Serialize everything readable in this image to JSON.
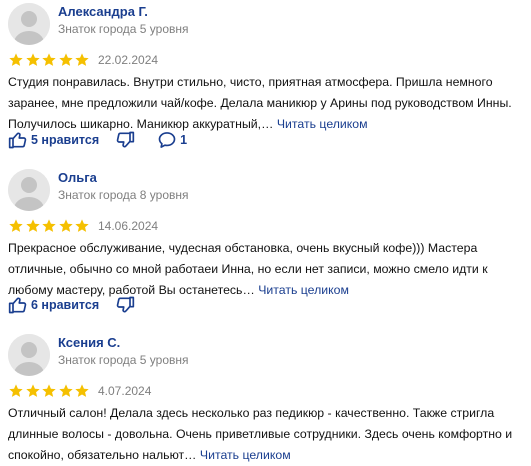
{
  "colors": {
    "link": "#1a3e8f",
    "star": "#f5c000",
    "meta": "#7f7f7f"
  },
  "icons": [
    "avatar-placeholder",
    "star-icon",
    "thumbs-up-icon",
    "thumbs-down-icon",
    "comment-icon"
  ],
  "reviews": [
    {
      "author": "Александра Г.",
      "level": "Знаток города 5 уровня",
      "rating": 5,
      "date": "22.02.2024",
      "text": "Студия понравилась. Внутри стильно, чисто, приятная атмосфера. Пришла немного заранее, мне предложили чай/кофе. Делала маникюр у Арины под руководством Инны. Получилось шикарно. Маникюр аккуратный,…",
      "more": "Читать целиком",
      "likes": "5 нравится",
      "comments": "1"
    },
    {
      "author": "Ольга",
      "level": "Знаток города 8 уровня",
      "rating": 5,
      "date": "14.06.2024",
      "text": "Прекрасное обслуживание, чудесная обстановка, очень вкусный кофе))) Мастера отличные, обычно со мной работаеи Инна, но если нет записи, можно смело идти к любому мастеру, работой Вы останетесь…",
      "more": "Читать целиком",
      "likes": "6 нравится"
    },
    {
      "author": "Ксения С.",
      "level": "Знаток города 5 уровня",
      "rating": 5,
      "date": "4.07.2024",
      "text": "Отличный салон! Делала здесь несколько раз педикюр - качественно. Также стригла длинные волосы - довольна. Очень приветливые сотрудники. Здесь очень комфортно и спокойно, обязательно нальют…",
      "more": "Читать целиком"
    }
  ]
}
